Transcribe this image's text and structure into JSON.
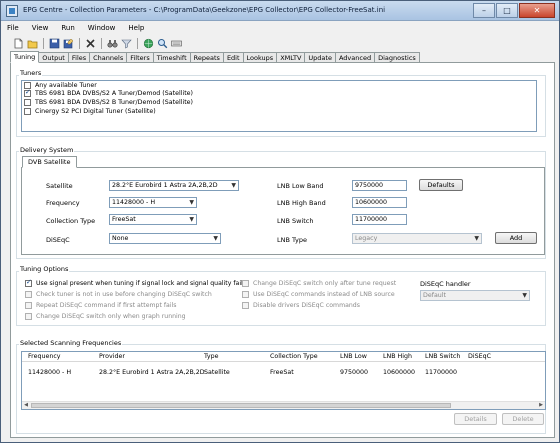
{
  "window": {
    "title": "EPG Centre - Collection Parameters - C:\\ProgramData\\Geekzone\\EPG Collector\\EPG Collector-FreeSat.ini",
    "minimize": "–",
    "maximize": "□",
    "close": "✕"
  },
  "menu": [
    "File",
    "View",
    "Run",
    "Window",
    "Help"
  ],
  "toolbar_icons": [
    "new-icon",
    "open-icon",
    "save-icon",
    "save-as-icon",
    "delete-icon",
    "binoculars-icon",
    "filter-icon",
    "globe-icon",
    "search-icon",
    "keyboard-icon"
  ],
  "tabs": [
    "Tuning",
    "Output",
    "Files",
    "Channels",
    "Filters",
    "Timeshift",
    "Repeats",
    "Edit",
    "Lookups",
    "XMLTV",
    "Update",
    "Advanced",
    "Diagnostics"
  ],
  "active_tab": "Tuning",
  "tuners": {
    "label": "Tuners",
    "items": [
      {
        "label": "Any available Tuner",
        "checked": false
      },
      {
        "label": "TBS 6981 BDA DVBS/S2 A Tuner/Demod (Satellite)",
        "checked": true
      },
      {
        "label": "TBS 6981 BDA DVBS/S2 B Tuner/Demod (Satellite)",
        "checked": false
      },
      {
        "label": "Cinergy S2 PCI Digital Tuner (Satellite)",
        "checked": false
      }
    ]
  },
  "delivery": {
    "label": "Delivery System",
    "subtab": "DVB Satellite",
    "satellite_label": "Satellite",
    "satellite_value": "28.2°E Eurobird 1  Astra 2A,2B,2D",
    "frequency_label": "Frequency",
    "frequency_value": "11428000 - H",
    "collection_type_label": "Collection Type",
    "collection_type_value": "FreeSat",
    "diseqc_label": "DiSEqC",
    "diseqc_value": "None",
    "lnb_low_label": "LNB Low Band",
    "lnb_low_value": "9750000",
    "lnb_high_label": "LNB High Band",
    "lnb_high_value": "10600000",
    "lnb_switch_label": "LNB Switch",
    "lnb_switch_value": "11700000",
    "lnb_type_label": "LNB Type",
    "lnb_type_value": "Legacy",
    "defaults_button": "Defaults",
    "add_button": "Add"
  },
  "tuning_options": {
    "label": "Tuning Options",
    "col1": [
      {
        "label": "Use signal present when tuning if signal lock and signal quality fail",
        "checked": true,
        "enabled": true
      },
      {
        "label": "Check tuner is not in use before changing DiSEqC switch",
        "checked": false,
        "enabled": false
      },
      {
        "label": "Repeat DiSEqC command if first attempt fails",
        "checked": false,
        "enabled": false
      },
      {
        "label": "Change DiSEqC switch only when graph running",
        "checked": false,
        "enabled": false
      }
    ],
    "col2": [
      {
        "label": "Change DiSEqC switch only after tune request",
        "checked": false,
        "enabled": false
      },
      {
        "label": "Use DiSEqC commands instead of LNB source",
        "checked": false,
        "enabled": false
      },
      {
        "label": "Disable drivers DiSEqC commands",
        "checked": false,
        "enabled": false
      }
    ],
    "diseqc_handler_label": "DiSEqC handler",
    "diseqc_handler_value": "Default"
  },
  "frequencies": {
    "label": "Selected Scanning Frequencies",
    "columns": [
      "Frequency",
      "Provider",
      "Type",
      "Collection Type",
      "LNB Low",
      "LNB High",
      "LNB Switch",
      "DiSEqC"
    ],
    "rows": [
      [
        "11428000 - H",
        "28.2°E Eurobird 1  Astra 2A,2B,2D",
        "Satellite",
        "FreeSat",
        "9750000",
        "10600000",
        "11700000",
        ""
      ]
    ],
    "details_button": "Details",
    "delete_button": "Delete"
  }
}
